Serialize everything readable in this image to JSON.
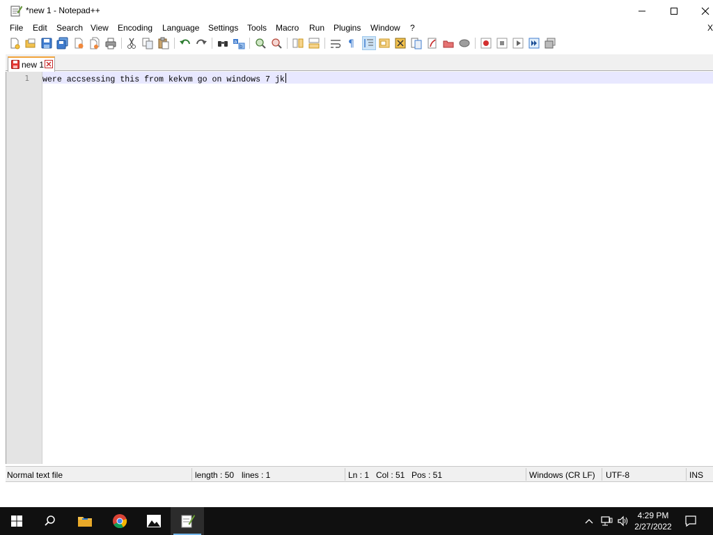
{
  "window": {
    "title": "*new 1 - Notepad++",
    "controls": {
      "minimize_icon": "minimize-icon",
      "maximize_icon": "maximize-icon",
      "close_icon": "close-icon"
    }
  },
  "menu": {
    "items": [
      "File",
      "Edit",
      "Search",
      "View",
      "Encoding",
      "Language",
      "Settings",
      "Tools",
      "Macro",
      "Run",
      "Plugins",
      "Window",
      "?"
    ],
    "overflow_close": "X"
  },
  "toolbar": {
    "buttons": [
      "new-file",
      "open-file",
      "save",
      "save-all",
      "close",
      "close-all",
      "print",
      "cut",
      "copy",
      "paste",
      "undo",
      "redo",
      "find",
      "replace",
      "zoom-in",
      "zoom-out",
      "sync-vertical",
      "sync-horizontal",
      "word-wrap",
      "show-all-characters",
      "indent-guide",
      "user-defined-language",
      "doc-map",
      "function-list",
      "folder-as-workspace",
      "doc-switcher",
      "record-macro",
      "stop-recording",
      "play-macro",
      "run-macro-multiple",
      "save-macro"
    ]
  },
  "tabs": [
    {
      "label": "new 1",
      "modified": true
    }
  ],
  "editor": {
    "line_number": "1",
    "text": "were accsessing this from kekvm go on windows 7 jk"
  },
  "status": {
    "file_type": "Normal text file",
    "length": "length : 50",
    "lines": "lines : 1",
    "ln": "Ln : 1",
    "col": "Col : 51",
    "pos": "Pos : 51",
    "eol": "Windows (CR LF)",
    "encoding": "UTF-8",
    "mode": "INS"
  },
  "taskbar": {
    "apps": [
      "start",
      "search",
      "file-explorer",
      "chrome",
      "photos",
      "notepad-plus-plus"
    ],
    "time": "4:29 PM",
    "date": "2/27/2022"
  },
  "colors": {
    "current_line": "#e8e8ff",
    "gutter": "#e4e4e4",
    "taskbar": "#101010",
    "tab_accent": "#f2a33a"
  }
}
